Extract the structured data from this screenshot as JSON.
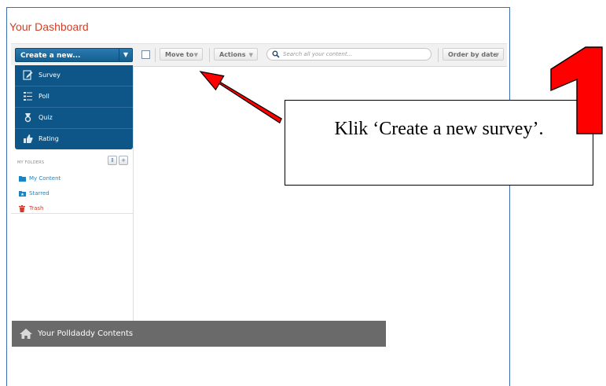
{
  "page": {
    "title": "Your Dashboard"
  },
  "toolbar": {
    "create_label": "Create a new...",
    "move_to_label": "Move to",
    "actions_label": "Actions",
    "search_placeholder": "Search all your content...",
    "order_label": "Order by date"
  },
  "create_menu": {
    "items": [
      {
        "label": "Survey",
        "icon": "survey-icon"
      },
      {
        "label": "Poll",
        "icon": "poll-icon"
      },
      {
        "label": "Quiz",
        "icon": "quiz-icon"
      },
      {
        "label": "Rating",
        "icon": "rating-icon"
      }
    ]
  },
  "folders": {
    "heading": "MY FOLDERS",
    "items": [
      {
        "label": "My Content",
        "color": "#1a85c4"
      },
      {
        "label": "Starred",
        "color": "#1a85c4"
      },
      {
        "label": "Trash",
        "color": "#d23a2a"
      }
    ]
  },
  "bottom_bar": {
    "label": "Your Polldaddy Contents"
  },
  "annotation": {
    "callout_text": "Klik ‘Create a new survey’.",
    "step_number": "1"
  },
  "colors": {
    "accent": "#0e5688",
    "title": "#d0402a",
    "annotation_red": "#ff0000"
  }
}
